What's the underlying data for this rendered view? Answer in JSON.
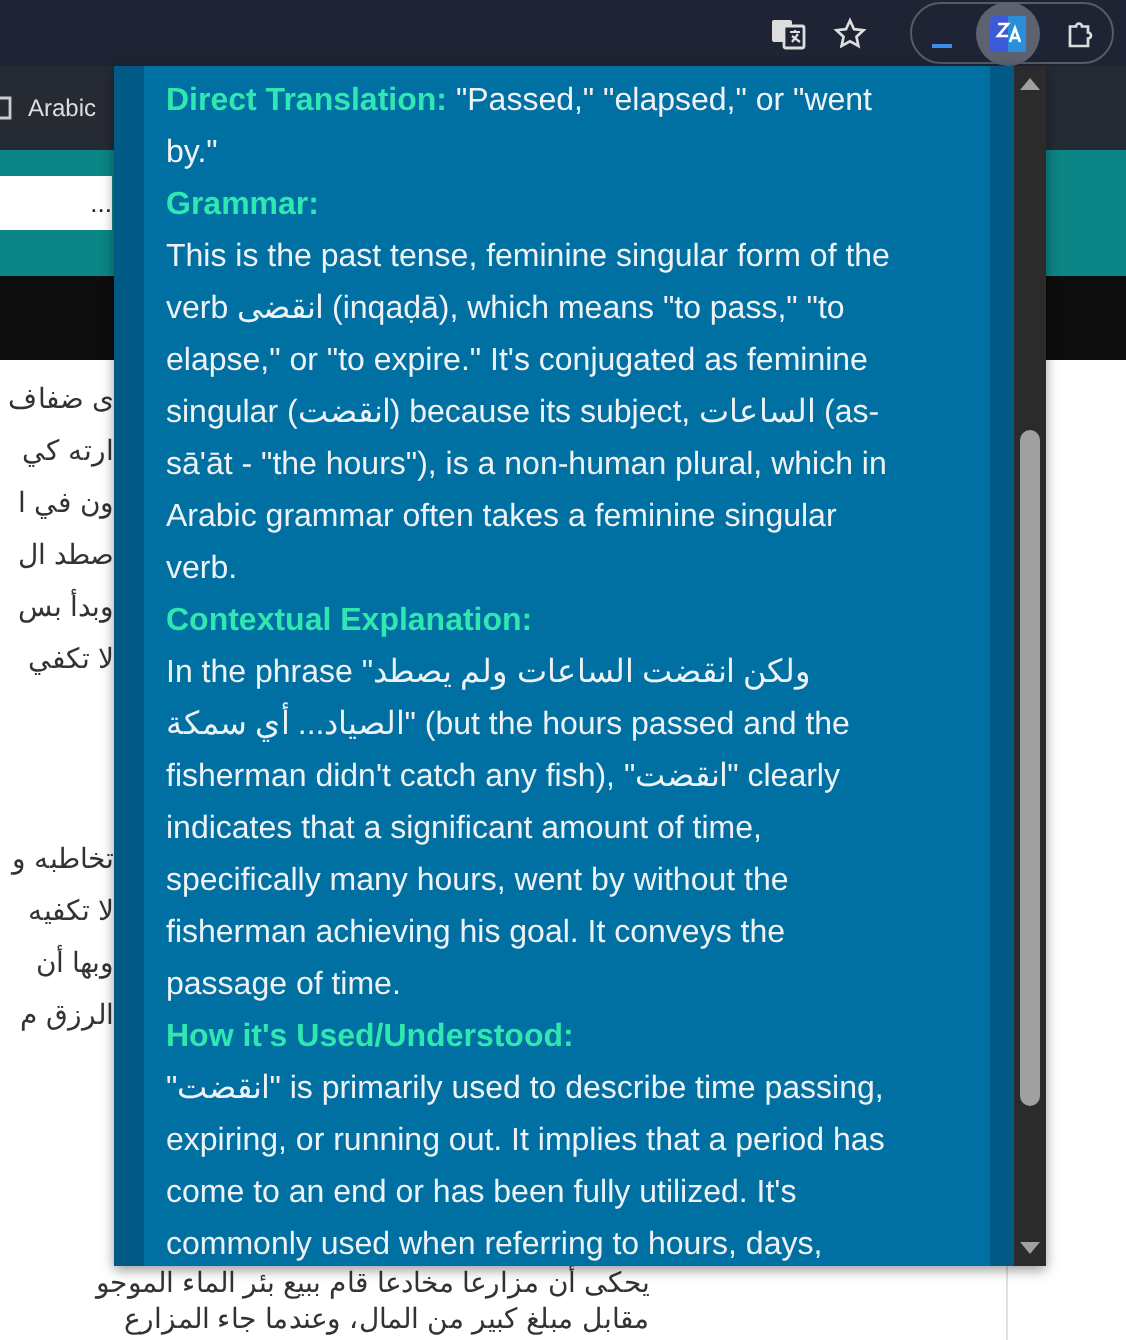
{
  "bookmarks_bar": {
    "items": [
      "Arabic"
    ]
  },
  "search_field": {
    "value": "..."
  },
  "article": {
    "fragments_upper": [
      "ى ضفاف",
      "ارته كي",
      "ون في ا",
      "صطد ال",
      "وبدأ بس",
      "لا تكفي"
    ],
    "fragments_lower": [
      "تخاطبه و",
      "لا تكفيه",
      "وبها أن",
      "الرزق م"
    ],
    "bottom_lines": [
      "يحكى أن مزارعا مخادعا قام ببيع بئر الماء الموجو",
      "مقابل مبلغ كبير من المال، وعندما جاء المزارع"
    ]
  },
  "popup": {
    "sections": [
      {
        "heading": "Direct Translation:",
        "inline": true,
        "text": "\"Passed,\" \"elapsed,\" or \"went by.\""
      },
      {
        "heading": "Grammar:",
        "inline": false,
        "text": "This is the past tense, feminine singular form of the verb انقضى (inqaḍā), which means \"to pass,\" \"to elapse,\" or \"to expire.\" It's conjugated as feminine singular (انقضت) because its subject, الساعات (as-sā'āt - \"the hours\"), is a non-human plural, which in Arabic grammar often takes a feminine singular verb."
      },
      {
        "heading": "Contextual Explanation:",
        "inline": false,
        "text": "In the phrase \"ولكن انقضت الساعات ولم يصطد الصياد... أي سمكة\" (but the hours passed and the fisherman didn't catch any fish), \"انقضت\" clearly indicates that a significant amount of time, specifically many hours, went by without the fisherman achieving his goal. It conveys the passage of time."
      },
      {
        "heading": "How it's Used/Understood:",
        "inline": false,
        "text": "\"انقضت\" is primarily used to describe time passing, expiring, or running out. It implies that a period has come to an end or has been fully utilized. It's commonly used when referring to hours, days,"
      }
    ]
  }
}
